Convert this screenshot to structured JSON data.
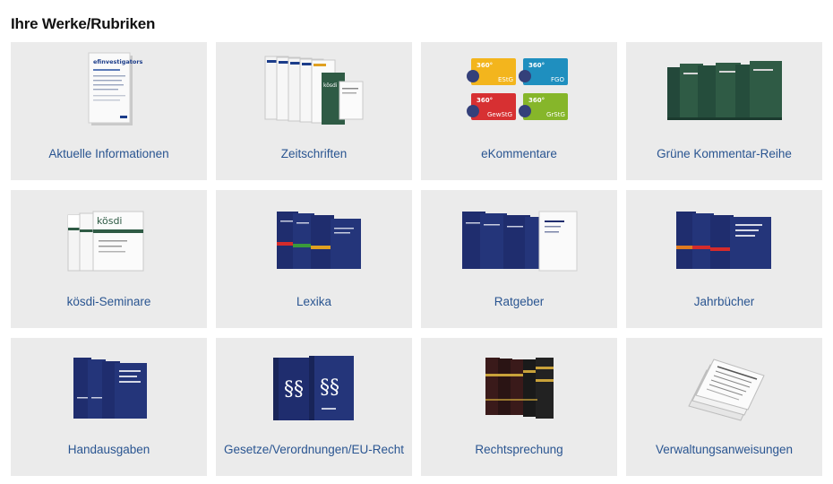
{
  "page": {
    "title": "Ihre Werke/Rubriken"
  },
  "tiles": [
    {
      "label": "Aktuelle Informationen",
      "icon": "newsletter-cover-icon"
    },
    {
      "label": "Zeitschriften",
      "icon": "magazine-stack-icon"
    },
    {
      "label": "eKommentare",
      "icon": "ekommentar-cards-icon"
    },
    {
      "label": "Grüne Kommentar-Reihe",
      "icon": "green-binders-icon"
    },
    {
      "label": "kösdi-Seminare",
      "icon": "koesdi-seminar-folders-icon"
    },
    {
      "label": "Lexika",
      "icon": "blue-lexicon-books-icon"
    },
    {
      "label": "Ratgeber",
      "icon": "guidebook-stack-icon"
    },
    {
      "label": "Jahrbücher",
      "icon": "yearbook-stack-icon"
    },
    {
      "label": "Handausgaben",
      "icon": "handbook-stack-icon"
    },
    {
      "label": "Gesetze/Verordnungen/EU-Recht",
      "icon": "paragraph-law-books-icon"
    },
    {
      "label": "Rechtsprechung",
      "icon": "dark-case-law-books-icon"
    },
    {
      "label": "Verwaltungsanweisungen",
      "icon": "document-pile-icon"
    }
  ],
  "art_text": {
    "newsletter": "efinvestigators",
    "koesdi": "kösdi",
    "ek_badges": [
      "EStG",
      "FGO",
      "GewStG",
      "GrStG"
    ],
    "ek_brand": "360°",
    "paragraph": "§§"
  },
  "colors": {
    "tile_bg": "#ebebeb",
    "label": "#2a5591",
    "navy": "#1f2d6e",
    "green": "#2f5b45"
  }
}
